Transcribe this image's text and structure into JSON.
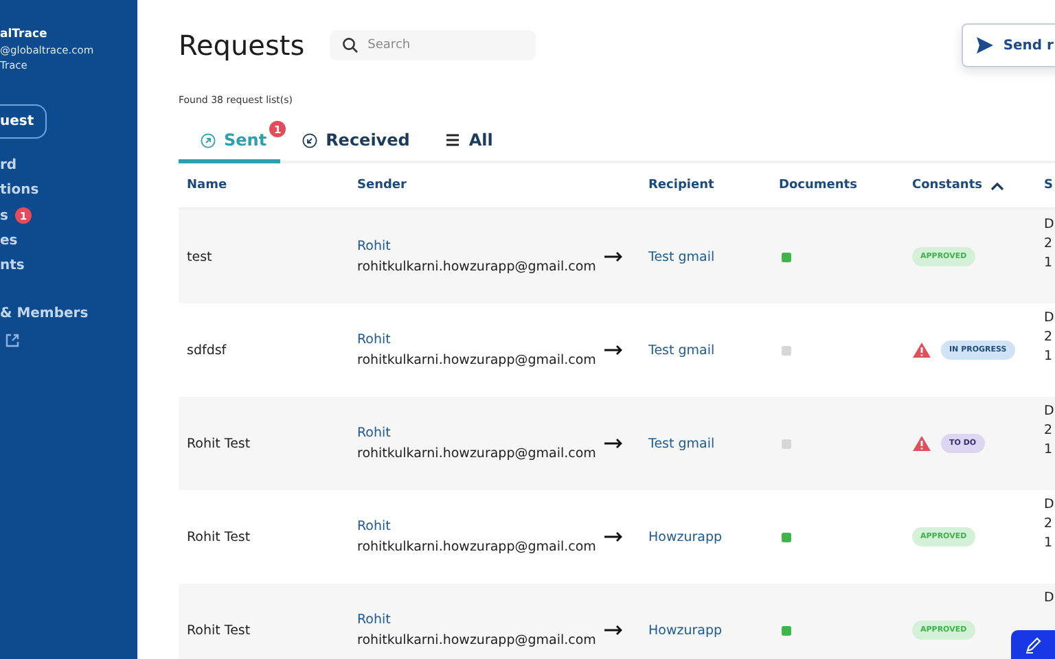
{
  "sidebar": {
    "org_name": "alTrace",
    "email": "@globaltrace.com",
    "org_sub": "Trace",
    "new_button": "uest",
    "items": [
      {
        "label": "rd"
      },
      {
        "label": "tions"
      },
      {
        "label": "s",
        "badge": "1"
      },
      {
        "label": "es"
      },
      {
        "label": "nts"
      }
    ],
    "members": "& Members"
  },
  "title": "Requests",
  "search": {
    "placeholder": "Search"
  },
  "send_button": "Send r",
  "found": "Found 38 request list(s)",
  "tabs": [
    {
      "label": "Sent",
      "kind": "sent",
      "badge": "1",
      "selected": true
    },
    {
      "label": "Received",
      "kind": "received",
      "selected": false
    },
    {
      "label": "All",
      "kind": "all",
      "selected": false
    }
  ],
  "table": {
    "columns": [
      "Name",
      "Sender",
      "Recipient",
      "Documents",
      "Constants",
      "S"
    ],
    "rows": [
      {
        "name": "test",
        "sender_name": "Rohit",
        "sender_email": "rohitkulkarni.howzurapp@gmail.com",
        "recipient": "Test gmail",
        "document": {
          "color": "#3cb54a"
        },
        "warning": false,
        "status": {
          "label": "APPROVED",
          "kind": "approved"
        },
        "date": [
          "D",
          "2",
          "1"
        ]
      },
      {
        "name": "sdfdsf",
        "sender_name": "Rohit",
        "sender_email": "rohitkulkarni.howzurapp@gmail.com",
        "recipient": "Test gmail",
        "document": {
          "color": "#d6d6d9"
        },
        "warning": true,
        "status": {
          "label": "IN PROGRESS",
          "kind": "in_progress"
        },
        "date": [
          "D",
          "2",
          "1"
        ]
      },
      {
        "name": "Rohit Test",
        "sender_name": "Rohit",
        "sender_email": "rohitkulkarni.howzurapp@gmail.com",
        "recipient": "Test gmail",
        "document": {
          "color": "#d6d6d9"
        },
        "warning": true,
        "status": {
          "label": "TO DO",
          "kind": "todo"
        },
        "date": [
          "D",
          "2",
          "1"
        ]
      },
      {
        "name": "Rohit Test",
        "sender_name": "Rohit",
        "sender_email": "rohitkulkarni.howzurapp@gmail.com",
        "recipient": "Howzurapp",
        "document": {
          "color": "#3cb54a"
        },
        "warning": false,
        "status": {
          "label": "APPROVED",
          "kind": "approved"
        },
        "date": [
          "D",
          "2",
          "1"
        ]
      },
      {
        "name": "Rohit Test",
        "sender_name": "Rohit",
        "sender_email": "rohitkulkarni.howzurapp@gmail.com",
        "recipient": "Howzurapp",
        "document": {
          "color": "#3cb54a"
        },
        "warning": false,
        "status": {
          "label": "APPROVED",
          "kind": "approved"
        },
        "date": [
          "D"
        ]
      }
    ]
  }
}
